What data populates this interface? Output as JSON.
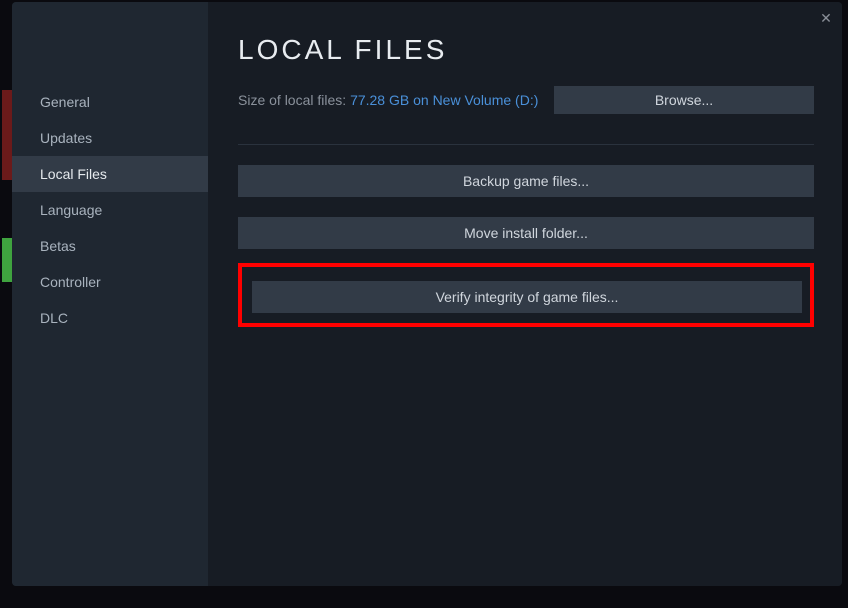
{
  "sidebar": {
    "items": [
      {
        "label": "General"
      },
      {
        "label": "Updates"
      },
      {
        "label": "Local Files"
      },
      {
        "label": "Language"
      },
      {
        "label": "Betas"
      },
      {
        "label": "Controller"
      },
      {
        "label": "DLC"
      }
    ],
    "selected_index": 2
  },
  "page": {
    "title": "LOCAL FILES",
    "size_label": "Size of local files: ",
    "size_value": "77.28 GB on New Volume (D:)",
    "browse_label": "Browse...",
    "backup_label": "Backup game files...",
    "move_label": "Move install folder...",
    "verify_label": "Verify integrity of game files..."
  }
}
